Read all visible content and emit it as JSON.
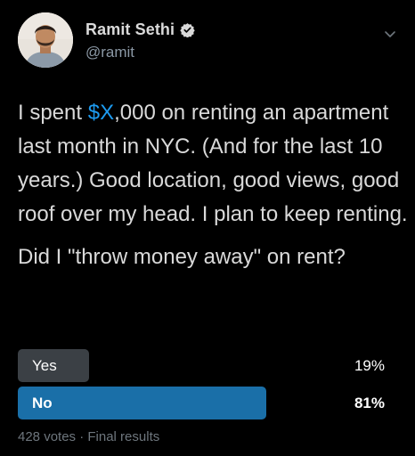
{
  "author": {
    "display_name": "Ramit Sethi",
    "handle": "@ramit",
    "verified": true
  },
  "tweet": {
    "line1_pre": "I spent ",
    "money": "$X",
    "line1_post": ",000 on renting an apartment last month in NYC. (And for the last 10 years.) Good location, good views, good roof over my head. I plan to keep renting.",
    "question": "Did I \"throw money away\" on rent?"
  },
  "poll": {
    "options": [
      {
        "label": "Yes",
        "percent_text": "19%",
        "percent": 19,
        "winner": false
      },
      {
        "label": "No",
        "percent_text": "81%",
        "percent": 81,
        "winner": true
      }
    ],
    "meta": "428 votes · Final results"
  },
  "colors": {
    "background": "#000000",
    "accent": "#1d9bf0",
    "winner_bar": "#1a6fa8",
    "loser_bar": "#3b4045"
  },
  "icons": {
    "verified": "verified-badge-icon",
    "more": "chevron-down-icon"
  }
}
